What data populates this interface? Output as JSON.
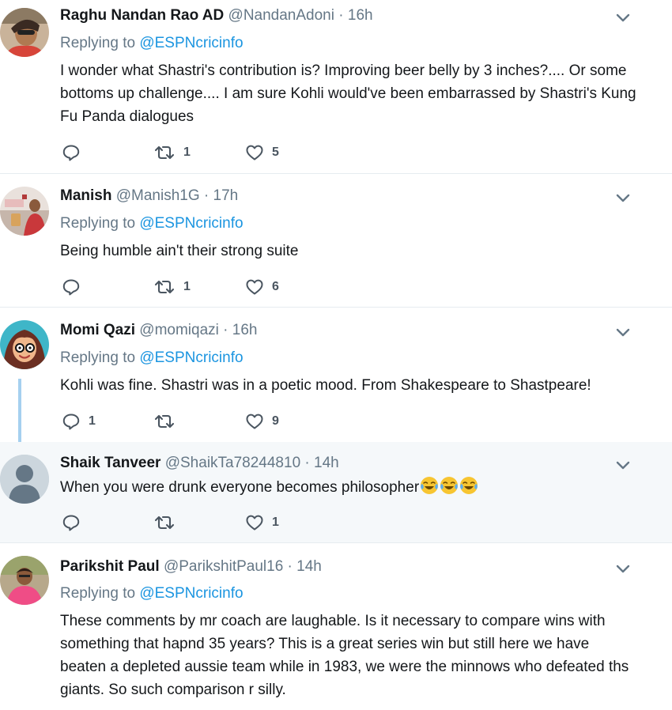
{
  "tweets": [
    {
      "name": "Raghu Nandan Rao AD",
      "handle": "@NandanAdoni",
      "separator": "·",
      "time": "16h",
      "replying_prefix": "Replying to",
      "replying_to": "@ESPNcricinfo",
      "text": "I wonder what Shastri's contribution is? Improving beer belly by 3 inches?.... Or some bottoms up challenge.... I am sure Kohli would've been embarrassed by Shastri's Kung Fu Panda dialogues",
      "replies": "",
      "retweets": "1",
      "likes": "5"
    },
    {
      "name": "Manish",
      "handle": "@Manish1G",
      "separator": "·",
      "time": "17h",
      "replying_prefix": "Replying to",
      "replying_to": "@ESPNcricinfo",
      "text": "Being humble ain't their strong suite",
      "replies": "",
      "retweets": "1",
      "likes": "6"
    },
    {
      "name": "Momi Qazi",
      "handle": "@momiqazi",
      "separator": "·",
      "time": "16h",
      "replying_prefix": "Replying to",
      "replying_to": "@ESPNcricinfo",
      "text": "Kohli was fine. Shastri was in a poetic mood. From Shakespeare to Shastpeare!",
      "replies": "1",
      "retweets": "",
      "likes": "9"
    },
    {
      "name": "Shaik Tanveer",
      "handle": "@ShaikTa78244810",
      "separator": "·",
      "time": "14h",
      "text": "When you were drunk everyone becomes philosopher",
      "emoji": [
        "face-with-tears-of-joy",
        "face-with-tears-of-joy",
        "face-with-tears-of-joy"
      ],
      "replies": "",
      "retweets": "",
      "likes": "1"
    },
    {
      "name": "Parikshit Paul",
      "handle": "@ParikshitPaul16",
      "separator": "·",
      "time": "14h",
      "replying_prefix": "Replying to",
      "replying_to": "@ESPNcricinfo",
      "text": "These comments by mr coach are laughable. Is it necessary to compare wins with something that hapnd 35 years? This is a great series win but still here we have beaten a depleted aussie team while in 1983, we were the minnows who defeated ths giants. So such comparison r silly."
    }
  ],
  "colors": {
    "link": "#1b95e0",
    "muted": "#657786",
    "thread_line": "#a5d0ef",
    "highlight_bg": "#f5f8fa",
    "divider": "#e6ecf0"
  },
  "icons": [
    "reply-icon",
    "retweet-icon",
    "like-icon",
    "caret-down-icon",
    "default-avatar-icon",
    "face-with-tears-of-joy-emoji"
  ]
}
